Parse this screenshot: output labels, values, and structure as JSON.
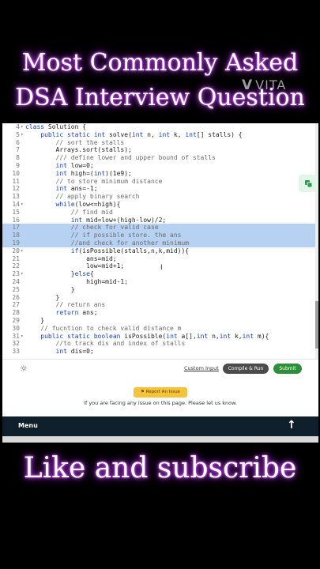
{
  "overlay": {
    "title_line1": "Most Commonly Asked",
    "title_line2": "DSA Interview Question",
    "bottom_text": "Like and subscribe",
    "watermark": "VITA",
    "watermark_logo": "V"
  },
  "editor": {
    "lines": [
      {
        "n": "4",
        "code": "class Solution {",
        "kind": "plain",
        "fold": true
      },
      {
        "n": "5",
        "code": "    public static int solve(int n, int k, int[] stalls) {",
        "kind": "plain",
        "fold": true
      },
      {
        "n": "6",
        "code": "        // sort the stalls",
        "kind": "comment",
        "fold": false
      },
      {
        "n": "7",
        "code": "        Arrays.sort(stalls);",
        "kind": "plain",
        "fold": false
      },
      {
        "n": "8",
        "code": "        /// define lower and upper bound of stalls",
        "kind": "comment",
        "fold": false
      },
      {
        "n": "9",
        "code": "        int low=0;",
        "kind": "plain",
        "fold": false
      },
      {
        "n": "10",
        "code": "        int high=(int)(1e9);",
        "kind": "plain",
        "fold": false
      },
      {
        "n": "11",
        "code": "        // to store minimum distance",
        "kind": "comment",
        "fold": false
      },
      {
        "n": "12",
        "code": "        int ans=-1;",
        "kind": "plain",
        "fold": false
      },
      {
        "n": "13",
        "code": "        // apply binary search",
        "kind": "comment",
        "fold": false
      },
      {
        "n": "14",
        "code": "        while(low<=high){",
        "kind": "plain",
        "fold": true
      },
      {
        "n": "15",
        "code": "            // find mid",
        "kind": "comment",
        "fold": false
      },
      {
        "n": "16",
        "code": "            int mid=low+(high-low)/2;",
        "kind": "plain",
        "fold": false
      },
      {
        "n": "17",
        "code": "            // check for valid case",
        "kind": "comment",
        "fold": false
      },
      {
        "n": "18",
        "code": "            // if possible store. the ans",
        "kind": "comment",
        "fold": false
      },
      {
        "n": "19",
        "code": "            //and check for another minimum",
        "kind": "comment",
        "fold": false
      },
      {
        "n": "20",
        "code": "            if(isPossible(stalls,n,k,mid)){",
        "kind": "plain",
        "fold": true
      },
      {
        "n": "21",
        "code": "                ans=mid;",
        "kind": "plain",
        "fold": false
      },
      {
        "n": "22",
        "code": "                low=mid+1;",
        "kind": "plain",
        "fold": false
      },
      {
        "n": "23",
        "code": "            }else{",
        "kind": "plain",
        "fold": true
      },
      {
        "n": "24",
        "code": "                high=mid-1;",
        "kind": "plain",
        "fold": false
      },
      {
        "n": "25",
        "code": "            }",
        "kind": "plain",
        "fold": false
      },
      {
        "n": "26",
        "code": "        }",
        "kind": "plain",
        "fold": false
      },
      {
        "n": "27",
        "code": "        // return ans",
        "kind": "comment",
        "fold": false
      },
      {
        "n": "28",
        "code": "        return ans;",
        "kind": "plain",
        "fold": false
      },
      {
        "n": "29",
        "code": "    }",
        "kind": "plain",
        "fold": false
      },
      {
        "n": "30",
        "code": "    // fucntion to check valid distance m",
        "kind": "comment",
        "fold": false
      },
      {
        "n": "31",
        "code": "    public static boolean isPossible(int a[],int n,int k,int m){",
        "kind": "plain",
        "fold": true
      },
      {
        "n": "32",
        "code": "        //to track dis and index of stalls",
        "kind": "comment",
        "fold": false
      },
      {
        "n": "33",
        "code": "        int dis=0;",
        "kind": "plain",
        "fold": false
      }
    ],
    "selected_lines": [
      "17",
      "18",
      "19"
    ]
  },
  "toolbar": {
    "custom_input": "Custom Input",
    "compile_run": "Compile & Run",
    "submit": "Submit"
  },
  "report": {
    "button": "Report An Issue",
    "message": "If you are facing any issue on this page. Please let us know."
  },
  "menubar": {
    "menu_label": "Menu"
  },
  "icons": {
    "theme": "lightbulb-icon",
    "float": "copy-icon",
    "scroll_top": "arrow-up-icon"
  },
  "colors": {
    "glow": "#b02cff",
    "submit": "#2f8e3c",
    "compile": "#4b4b4b",
    "report": "#f2c33b",
    "menubar": "#0f1f2b",
    "selection": "#b6d1f2"
  }
}
